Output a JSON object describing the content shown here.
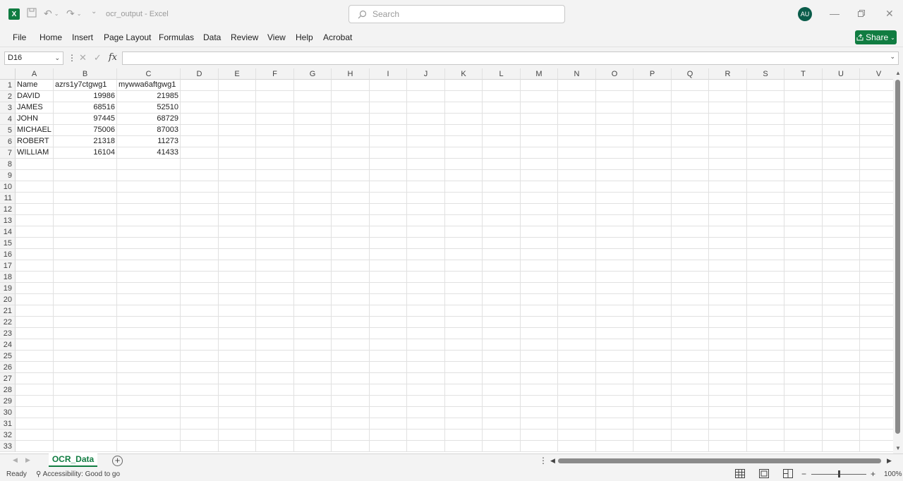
{
  "app": {
    "doc_title": "ocr_output",
    "app_name": "Excel",
    "title_separator": " - ",
    "search_placeholder": "Search",
    "avatar_initials": "AU",
    "accent_color": "#107c41"
  },
  "ribbon": {
    "tabs": [
      "File",
      "Home",
      "Insert",
      "Page Layout",
      "Formulas",
      "Data",
      "Review",
      "View",
      "Help",
      "Acrobat"
    ],
    "share_label": "Share"
  },
  "formula_bar": {
    "name_box": "D16",
    "fx_label": "fx",
    "formula": ""
  },
  "sheet": {
    "columns": [
      "A",
      "B",
      "C",
      "D",
      "E",
      "F",
      "G",
      "H",
      "I",
      "J",
      "K",
      "L",
      "M",
      "N",
      "O",
      "P",
      "Q",
      "R",
      "S",
      "T",
      "U",
      "V"
    ],
    "row_count": 33,
    "rows": [
      [
        "Name",
        "azrs1y7ctgwg1",
        "mywwa6aftgwg1"
      ],
      [
        "DAVID",
        "19986",
        "21985"
      ],
      [
        "JAMES",
        "68516",
        "52510"
      ],
      [
        "JOHN",
        "97445",
        "68729"
      ],
      [
        "MICHAEL",
        "75006",
        "87003"
      ],
      [
        "ROBERT",
        "21318",
        "11273"
      ],
      [
        "WILLIAM",
        "16104",
        "41433"
      ]
    ]
  },
  "sheet_tabs": {
    "active": "OCR_Data"
  },
  "status": {
    "ready": "Ready",
    "accessibility": "Accessibility: Good to go",
    "zoom": "100%"
  }
}
